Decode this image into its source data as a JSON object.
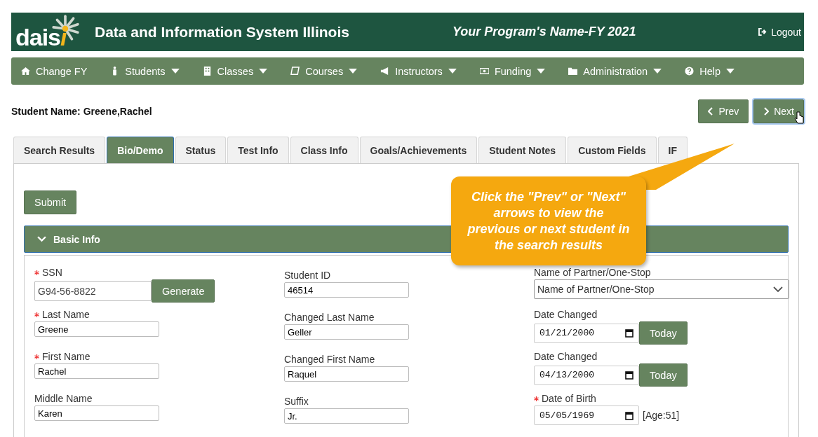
{
  "header": {
    "logo": {
      "text": "dais",
      "accent": "i"
    },
    "title": "Data and Information System Illinois",
    "program": "Your Program's Name-FY 2021",
    "logout": "Logout"
  },
  "nav": [
    {
      "label": "Change FY",
      "kind": "home",
      "dropdown": false
    },
    {
      "label": "Students",
      "kind": "person",
      "dropdown": true
    },
    {
      "label": "Classes",
      "kind": "building",
      "dropdown": true
    },
    {
      "label": "Courses",
      "kind": "book",
      "dropdown": true
    },
    {
      "label": "Instructors",
      "kind": "megaphone",
      "dropdown": true
    },
    {
      "label": "Funding",
      "kind": "money",
      "dropdown": true
    },
    {
      "label": "Administration",
      "kind": "folder",
      "dropdown": true
    },
    {
      "label": "Help",
      "kind": "question",
      "dropdown": true
    }
  ],
  "student_name": "Student Name: Greene,Rachel",
  "pager": {
    "prev": "Prev",
    "next": "Next"
  },
  "tabs": [
    {
      "label": "Search Results",
      "selected": false
    },
    {
      "label": "Bio/Demo",
      "selected": true
    },
    {
      "label": "Status",
      "selected": false
    },
    {
      "label": "Test Info",
      "selected": false
    },
    {
      "label": "Class Info",
      "selected": false
    },
    {
      "label": "Goals/Achievements",
      "selected": false
    },
    {
      "label": "Student Notes",
      "selected": false
    },
    {
      "label": "Custom Fields",
      "selected": false
    },
    {
      "label": "IF",
      "selected": false
    }
  ],
  "submit": "Submit",
  "section": {
    "title": "Basic Info",
    "expanded": true
  },
  "columns": [
    [
      {
        "kind": "text",
        "label": "SSN",
        "required": true,
        "value": "G94-56-8822",
        "button": "Generate"
      },
      {
        "kind": "text",
        "label": "Last Name",
        "required": true,
        "value": "Greene"
      },
      {
        "kind": "text",
        "label": "First Name",
        "required": true,
        "value": "Rachel"
      },
      {
        "kind": "text",
        "label": "Middle Name",
        "required": false,
        "value": "Karen"
      }
    ],
    [
      {
        "kind": "text",
        "label": "Student ID",
        "required": false,
        "value": "46514"
      },
      {
        "kind": "text",
        "label": "Changed Last Name",
        "required": false,
        "value": "Geller"
      },
      {
        "kind": "text",
        "label": "Changed First Name",
        "required": false,
        "value": "Raquel"
      },
      {
        "kind": "text",
        "label": "Suffix",
        "required": false,
        "value": "Jr."
      }
    ],
    [
      {
        "kind": "select",
        "label": "Name of Partner/One-Stop",
        "required": false,
        "value": "Name of Partner/One-Stop"
      },
      {
        "kind": "date",
        "label": "Date Changed",
        "required": false,
        "value": "01/21/2000",
        "button": "Today"
      },
      {
        "kind": "date",
        "label": "Date Changed",
        "required": false,
        "value": "04/13/2000",
        "button": "Today"
      },
      {
        "kind": "date",
        "label": "Date of Birth",
        "required": true,
        "value": "05/05/1969",
        "suffix": "[Age:51]"
      }
    ]
  ],
  "callout": "Click the \"Prev\" or \"Next\" arrows to view the previous or next student in the search results"
}
